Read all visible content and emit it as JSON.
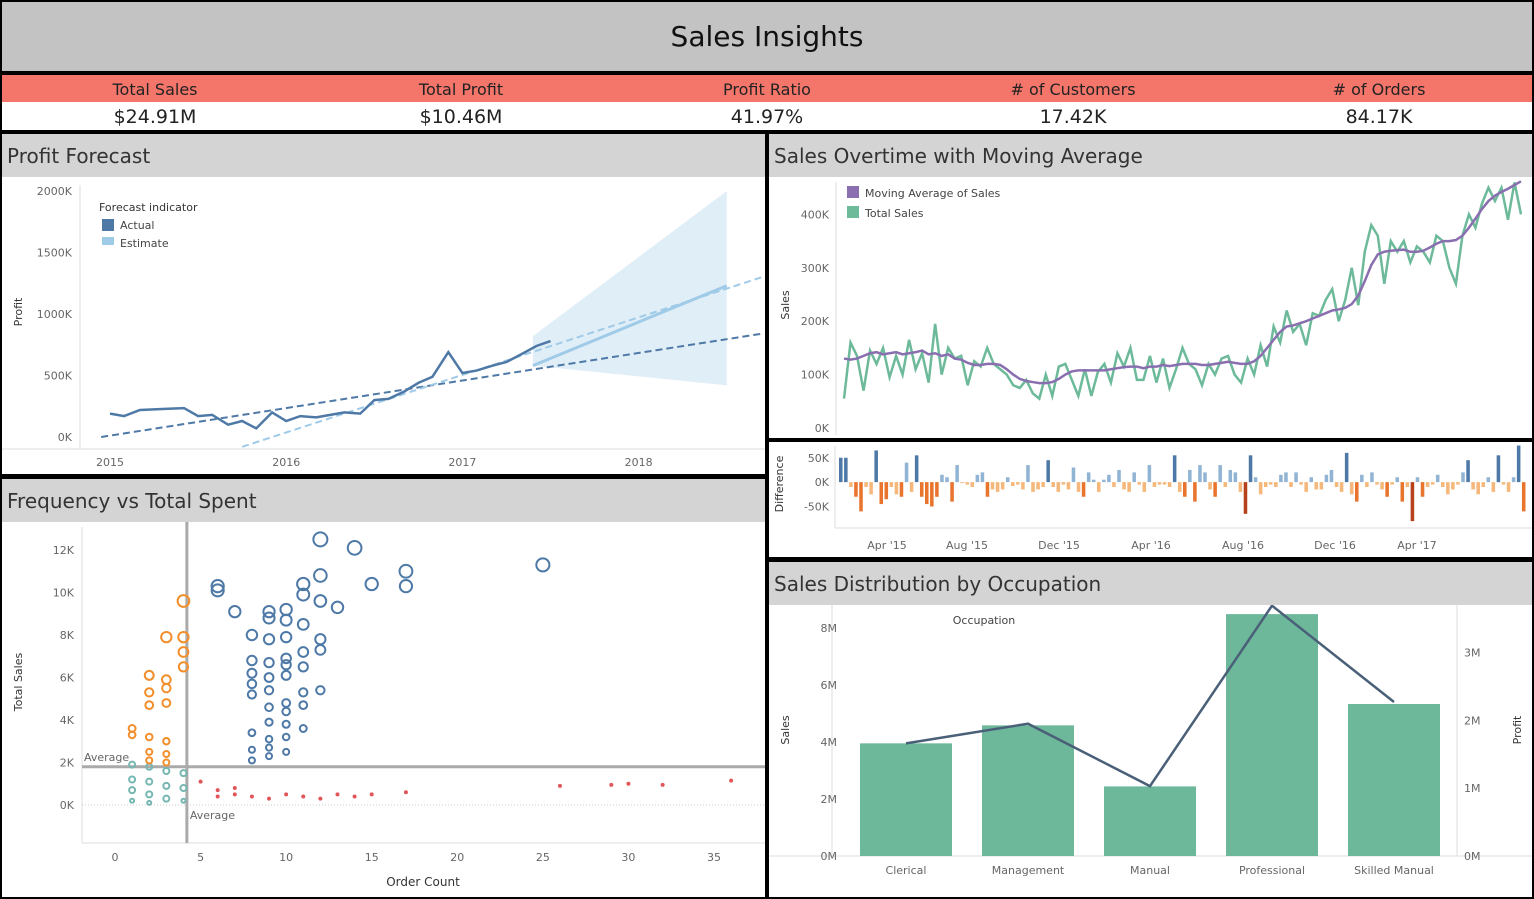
{
  "header": {
    "title": "Sales Insights"
  },
  "kpis": [
    {
      "label": "Total Sales",
      "value": "$24.91M"
    },
    {
      "label": "Total Profit",
      "value": "$10.46M"
    },
    {
      "label": "Profit Ratio",
      "value": "41.97%"
    },
    {
      "label": "# of Customers",
      "value": "17.42K"
    },
    {
      "label": "# of Orders",
      "value": "84.17K"
    }
  ],
  "colors": {
    "kpi_band": "#f4766b",
    "header": "#c3c3c3",
    "panel_title": "#d4d4d4",
    "actual": "#4e79a7",
    "estimate": "#a0cbe8",
    "moving_avg": "#8a6fb0",
    "total_sales": "#6dba9a",
    "positive": "#4e79a7",
    "negative": "#f28e2b",
    "bar": "#6db89a",
    "profit_line": "#4a6078"
  },
  "panels": {
    "forecast": "Profit Forecast",
    "movavg": "Sales Overtime with Moving Average",
    "freq": "Frequency vs Total Spent",
    "occupation": "Sales Distribution by Occupation"
  },
  "chart_data": [
    {
      "id": "forecast",
      "type": "line",
      "title": "Profit Forecast",
      "ylabel": "Profit",
      "x_ticks": [
        "2015",
        "2016",
        "2017",
        "2018"
      ],
      "y_ticks": [
        "0K",
        "500K",
        "1000K",
        "1500K",
        "2000K"
      ],
      "ylim": [
        0,
        2000000
      ],
      "xlim": [
        2015.0,
        2018.7
      ],
      "legend": {
        "title": "Forecast indicator",
        "items": [
          "Actual",
          "Estimate"
        ],
        "placement": "top-left"
      },
      "actual": {
        "x": [
          2015.0,
          2015.08,
          2015.17,
          2015.25,
          2015.33,
          2015.42,
          2015.5,
          2015.58,
          2015.67,
          2015.75,
          2015.83,
          2015.92,
          2016.0,
          2016.08,
          2016.17,
          2016.25,
          2016.33,
          2016.42,
          2016.5,
          2016.58,
          2016.67,
          2016.75,
          2016.83,
          2016.92,
          2017.0,
          2017.08,
          2017.17,
          2017.25,
          2017.33,
          2017.42,
          2017.5
        ],
        "y": [
          190000,
          170000,
          220000,
          225000,
          230000,
          235000,
          170000,
          180000,
          100000,
          130000,
          70000,
          200000,
          130000,
          170000,
          160000,
          180000,
          200000,
          190000,
          300000,
          310000,
          370000,
          440000,
          490000,
          690000,
          520000,
          540000,
          580000,
          610000,
          670000,
          740000,
          780000
        ]
      },
      "actual_trend": {
        "x": [
          2014.95,
          2018.7
        ],
        "y": [
          0,
          840000
        ]
      },
      "estimate_trend": {
        "x": [
          2015.75,
          2018.7
        ],
        "y": [
          -80000,
          1300000
        ]
      },
      "forecast": {
        "x": [
          2017.4,
          2018.5
        ],
        "y": [
          580000,
          1230000
        ]
      },
      "forecast_band": {
        "x": [
          2017.4,
          2018.5
        ],
        "upper": [
          820000,
          2000000
        ],
        "lower": [
          580000,
          420000
        ]
      }
    },
    {
      "id": "movavg",
      "type": "line",
      "title": "Sales Overtime with Moving Average",
      "ylabel": "Sales",
      "y_ticks": [
        "0K",
        "100K",
        "200K",
        "300K",
        "400K"
      ],
      "ylim": [
        0,
        470000
      ],
      "legend": {
        "items": [
          "Moving Average of Sales",
          "Total Sales"
        ],
        "placement": "top-left"
      },
      "series": [
        {
          "name": "Total Sales",
          "values": [
            55000,
            160000,
            135000,
            70000,
            145000,
            120000,
            150000,
            95000,
            135000,
            100000,
            165000,
            110000,
            140000,
            85000,
            195000,
            100000,
            150000,
            130000,
            135000,
            80000,
            125000,
            115000,
            150000,
            120000,
            110000,
            100000,
            80000,
            75000,
            90000,
            65000,
            55000,
            100000,
            60000,
            115000,
            120000,
            90000,
            60000,
            110000,
            60000,
            105000,
            120000,
            85000,
            140000,
            115000,
            150000,
            90000,
            90000,
            135000,
            85000,
            130000,
            75000,
            110000,
            150000,
            120000,
            110000,
            80000,
            120000,
            100000,
            130000,
            135000,
            100000,
            85000,
            130000,
            100000,
            155000,
            115000,
            190000,
            160000,
            220000,
            180000,
            195000,
            155000,
            215000,
            210000,
            240000,
            260000,
            200000,
            240000,
            300000,
            230000,
            330000,
            380000,
            360000,
            270000,
            350000,
            330000,
            350000,
            310000,
            340000,
            330000,
            310000,
            360000,
            350000,
            300000,
            270000,
            360000,
            400000,
            375000,
            420000,
            450000,
            425000,
            450000,
            390000,
            460000,
            400000
          ]
        },
        {
          "name": "Moving Average of Sales",
          "values": [
            130000,
            128000,
            130000,
            135000,
            140000,
            142000,
            138000,
            140000,
            142000,
            138000,
            140000,
            142000,
            145000,
            138000,
            140000,
            135000,
            138000,
            130000,
            128000,
            122000,
            118000,
            118000,
            120000,
            120000,
            118000,
            110000,
            100000,
            92000,
            88000,
            86000,
            84000,
            84000,
            86000,
            92000,
            100000,
            106000,
            108000,
            108000,
            108000,
            108000,
            108000,
            110000,
            112000,
            114000,
            115000,
            115000,
            112000,
            115000,
            115000,
            118000,
            116000,
            118000,
            120000,
            120000,
            120000,
            118000,
            118000,
            120000,
            122000,
            124000,
            122000,
            120000,
            120000,
            125000,
            135000,
            150000,
            165000,
            180000,
            190000,
            192000,
            196000,
            200000,
            205000,
            210000,
            215000,
            220000,
            222000,
            225000,
            232000,
            248000,
            275000,
            305000,
            325000,
            330000,
            332000,
            333000,
            334000,
            330000,
            330000,
            332000,
            338000,
            345000,
            350000,
            350000,
            352000,
            360000,
            375000,
            392000,
            410000,
            425000,
            435000,
            442000,
            448000,
            455000,
            462000
          ]
        }
      ]
    },
    {
      "id": "difference",
      "type": "bar",
      "ylabel": "Difference",
      "y_ticks": [
        "50K",
        "0K",
        "-50K"
      ],
      "ylim": [
        -90000,
        70000
      ],
      "x_ticks": [
        "Apr '15",
        "Aug '15",
        "Dec '15",
        "Apr '16",
        "Aug '16",
        "Dec '16",
        "Apr '17"
      ],
      "values": [
        50000,
        50000,
        -10000,
        -30000,
        -60000,
        -10000,
        -25000,
        65000,
        -45000,
        -35000,
        -10000,
        -25000,
        -30000,
        40000,
        -20000,
        55000,
        -30000,
        -45000,
        -50000,
        -30000,
        15000,
        10000,
        -40000,
        35000,
        -2000,
        -5000,
        -10000,
        15000,
        20000,
        -30000,
        -15000,
        -20000,
        -15000,
        10000,
        -8000,
        -5000,
        -15000,
        35000,
        -20000,
        -15000,
        -10000,
        45000,
        -10000,
        -20000,
        -5000,
        -15000,
        30000,
        -20000,
        -30000,
        20000,
        5000,
        -20000,
        5000,
        15000,
        -10000,
        25000,
        -15000,
        -20000,
        20000,
        -5000,
        -20000,
        35000,
        -10000,
        -5000,
        -5000,
        -10000,
        55000,
        -20000,
        -30000,
        25000,
        -40000,
        35000,
        20000,
        -15000,
        -30000,
        35000,
        -10000,
        25000,
        20000,
        -20000,
        -65000,
        55000,
        10000,
        -25000,
        -10000,
        -5000,
        -10000,
        15000,
        20000,
        -10000,
        20000,
        -5000,
        -20000,
        10000,
        -15000,
        -15000,
        15000,
        25000,
        -10000,
        -20000,
        60000,
        -25000,
        -40000,
        15000,
        -10000,
        20000,
        -5000,
        -15000,
        -30000,
        -5000,
        10000,
        -40000,
        -10000,
        -80000,
        10000,
        -30000,
        -10000,
        -5000,
        15000,
        -10000,
        -25000,
        -15000,
        -5000,
        20000,
        45000,
        -15000,
        -25000,
        -10000,
        10000,
        -20000,
        55000,
        -5000,
        -20000,
        10000,
        75000,
        -60000
      ]
    },
    {
      "id": "freq",
      "type": "scatter",
      "title": "Frequency vs Total Spent",
      "xlabel": "Order Count",
      "ylabel": "Total Sales",
      "x_ticks": [
        "0",
        "5",
        "10",
        "15",
        "20",
        "25",
        "30",
        "35"
      ],
      "y_ticks": [
        "0K",
        "2K",
        "4K",
        "6K",
        "8K",
        "10K",
        "12K"
      ],
      "xlim": [
        -2,
        38
      ],
      "ylim": [
        -400,
        12900
      ],
      "reference_lines": {
        "x_average": 4.2,
        "y_average": 1800,
        "label": "Average"
      },
      "groups": [
        {
          "name": "high_value",
          "color": "#4e79a7",
          "points": [
            [
              12,
              12500
            ],
            [
              14,
              12100
            ],
            [
              25,
              11300
            ],
            [
              17,
              11000
            ],
            [
              12,
              10800
            ],
            [
              11,
              10400
            ],
            [
              6,
              10300
            ],
            [
              6,
              10100
            ],
            [
              15,
              10400
            ],
            [
              17,
              10300
            ],
            [
              11,
              9900
            ],
            [
              12,
              9600
            ],
            [
              7,
              9100
            ],
            [
              9,
              9100
            ],
            [
              10,
              9200
            ],
            [
              13,
              9300
            ],
            [
              9,
              8800
            ],
            [
              10,
              8700
            ],
            [
              11,
              8500
            ],
            [
              8,
              8000
            ],
            [
              9,
              7800
            ],
            [
              10,
              7900
            ],
            [
              12,
              7800
            ],
            [
              12,
              7300
            ],
            [
              11,
              7200
            ],
            [
              10,
              6900
            ],
            [
              8,
              6800
            ],
            [
              9,
              6700
            ],
            [
              10,
              6600
            ],
            [
              11,
              6500
            ],
            [
              8,
              6200
            ],
            [
              9,
              6000
            ],
            [
              10,
              6100
            ],
            [
              8,
              5700
            ],
            [
              9,
              5400
            ],
            [
              11,
              5300
            ],
            [
              12,
              5400
            ],
            [
              8,
              5200
            ],
            [
              10,
              4800
            ],
            [
              9,
              4600
            ],
            [
              11,
              4700
            ],
            [
              10,
              4400
            ],
            [
              9,
              3900
            ],
            [
              10,
              3800
            ],
            [
              11,
              3600
            ],
            [
              8,
              3400
            ],
            [
              9,
              3100
            ],
            [
              10,
              3200
            ],
            [
              8,
              2600
            ],
            [
              9,
              2700
            ],
            [
              10,
              2500
            ],
            [
              8,
              2100
            ],
            [
              9,
              2300
            ]
          ]
        },
        {
          "name": "low_value",
          "color": "#e15759",
          "points": [
            [
              5,
              1100
            ],
            [
              6,
              700
            ],
            [
              6,
              400
            ],
            [
              7,
              800
            ],
            [
              7,
              500
            ],
            [
              8,
              400
            ],
            [
              9,
              300
            ],
            [
              10,
              500
            ],
            [
              11,
              400
            ],
            [
              12,
              300
            ],
            [
              13,
              500
            ],
            [
              14,
              400
            ],
            [
              15,
              500
            ],
            [
              17,
              600
            ],
            [
              26,
              900
            ],
            [
              29,
              950
            ],
            [
              30,
              1000
            ],
            [
              32,
              950
            ],
            [
              36,
              1150
            ]
          ]
        },
        {
          "name": "frequent_low",
          "color": "#76b7b2",
          "points": [
            [
              1,
              1900
            ],
            [
              1,
              1200
            ],
            [
              1,
              700
            ],
            [
              1,
              200
            ],
            [
              2,
              1800
            ],
            [
              2,
              1100
            ],
            [
              2,
              500
            ],
            [
              2,
              100
            ],
            [
              3,
              1600
            ],
            [
              3,
              900
            ],
            [
              3,
              300
            ],
            [
              4,
              1500
            ],
            [
              4,
              800
            ],
            [
              4,
              200
            ]
          ]
        },
        {
          "name": "infrequent_high",
          "color": "#f28e2b",
          "points": [
            [
              4,
              9600
            ],
            [
              3,
              7900
            ],
            [
              4,
              7900
            ],
            [
              4,
              7200
            ],
            [
              4,
              6500
            ],
            [
              2,
              6100
            ],
            [
              3,
              5900
            ],
            [
              2,
              5300
            ],
            [
              3,
              5500
            ],
            [
              2,
              4700
            ],
            [
              3,
              4800
            ],
            [
              1,
              3600
            ],
            [
              1,
              3300
            ],
            [
              2,
              3200
            ],
            [
              3,
              3000
            ],
            [
              2,
              2500
            ],
            [
              3,
              2400
            ],
            [
              2,
              2100
            ],
            [
              3,
              2000
            ]
          ]
        }
      ]
    },
    {
      "id": "occupation",
      "type": "bar",
      "title": "Sales Distribution by Occupation",
      "xlabel": "Occupation",
      "ylabel": "Sales",
      "y2label": "Profit",
      "categories": [
        "Clerical",
        "Management",
        "Manual",
        "Professional",
        "Skilled Manual"
      ],
      "y_ticks": [
        "0M",
        "2M",
        "4M",
        "6M",
        "8M"
      ],
      "y2_ticks": [
        "0M",
        "1M",
        "2M",
        "3M"
      ],
      "ylim": [
        0,
        8800000
      ],
      "y2lim": [
        0,
        3700000
      ],
      "series": [
        {
          "name": "Sales",
          "values": [
            3950000,
            4580000,
            2440000,
            8480000,
            5330000
          ]
        },
        {
          "name": "Profit",
          "values": [
            1660000,
            1950000,
            1030000,
            3690000,
            2270000
          ]
        }
      ]
    }
  ]
}
